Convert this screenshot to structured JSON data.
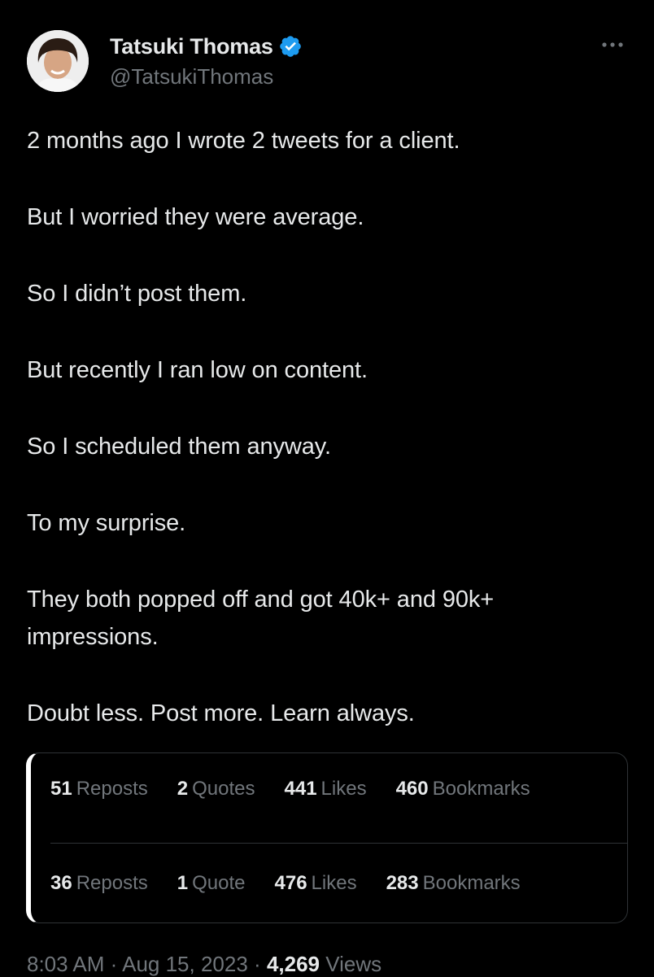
{
  "author": {
    "display_name": "Tatsuki Thomas",
    "handle": "@TatsukiThomas",
    "verified": true,
    "avatar_icon": "user-avatar"
  },
  "more_icon": "more-horizontal-icon",
  "tweet": {
    "paragraphs": [
      "2 months ago I wrote 2 tweets for a client.",
      "But I worried they were average.",
      "So I didn’t post them.",
      "But recently I ran low on content.",
      "So I scheduled them anyway.",
      "To my surprise.",
      "They both popped off and got 40k+ and 90k+ impressions.",
      "Doubt less. Post more. Learn always."
    ]
  },
  "embedded_stats": {
    "row1": {
      "reposts_count": "51",
      "reposts_label": "Reposts",
      "quotes_count": "2",
      "quotes_label": "Quotes",
      "likes_count": "441",
      "likes_label": "Likes",
      "bookmarks_count": "460",
      "bookmarks_label": "Bookmarks"
    },
    "row2": {
      "reposts_count": "36",
      "reposts_label": "Reposts",
      "quotes_count": "1",
      "quotes_label": "Quote",
      "likes_count": "476",
      "likes_label": "Likes",
      "bookmarks_count": "283",
      "bookmarks_label": "Bookmarks"
    }
  },
  "meta": {
    "time": "8:03 AM",
    "separator": "·",
    "date": "Aug 15, 2023",
    "views_count": "4,269",
    "views_label": "Views"
  },
  "colors": {
    "background": "#000000",
    "text_primary": "#e7e9ea",
    "text_secondary": "#71767b",
    "verified_blue": "#1d9bf0",
    "border": "#2f3336"
  }
}
